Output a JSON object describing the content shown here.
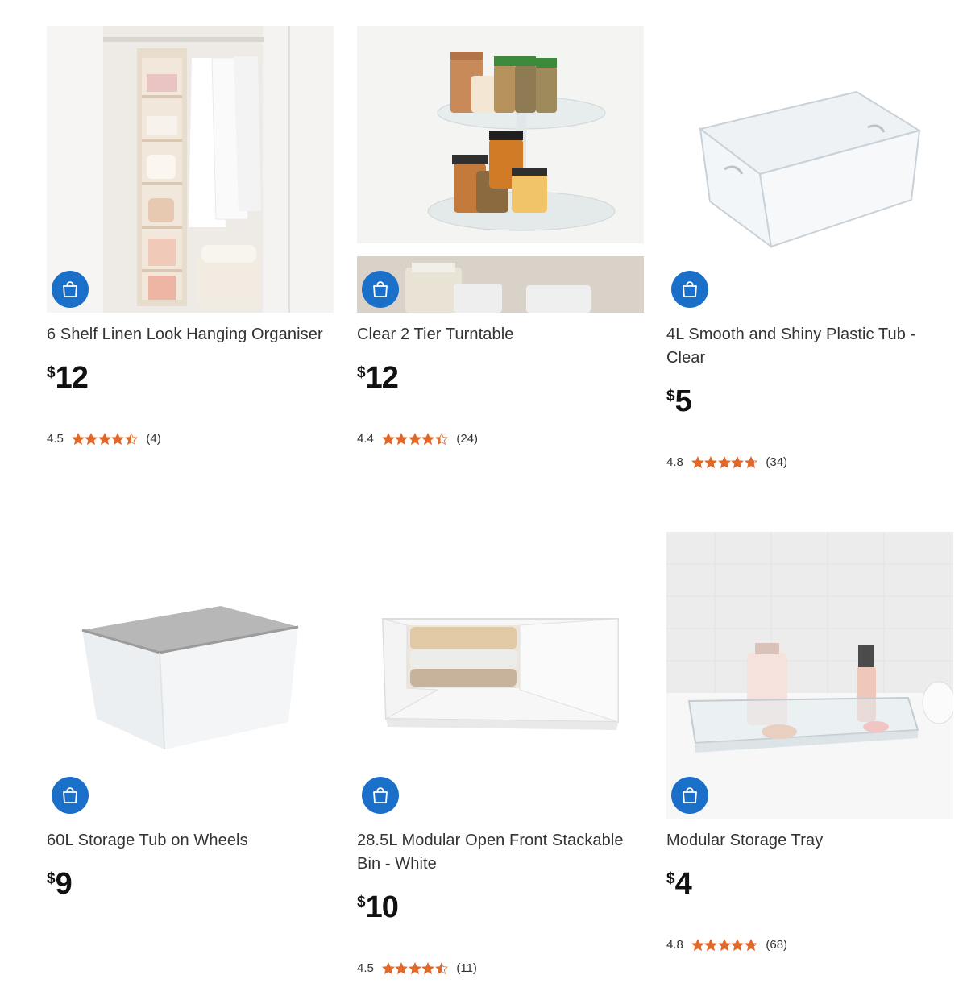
{
  "accent": "#1a6fc9",
  "star_color": "#e0692a",
  "products": [
    {
      "title": "6 Shelf Linen Look Hanging Organiser",
      "currency": "$",
      "price": "12",
      "rating": "4.5",
      "stars": 4.5,
      "count": "(4)",
      "cart_icon": "shopping-bag-icon"
    },
    {
      "title": "Clear 2 Tier Turntable",
      "currency": "$",
      "price": "12",
      "rating": "4.4",
      "stars": 4.4,
      "count": "(24)",
      "cart_icon": "shopping-bag-icon"
    },
    {
      "title": "4L Smooth and Shiny Plastic Tub - Clear",
      "currency": "$",
      "price": "5",
      "rating": "4.8",
      "stars": 4.8,
      "count": "(34)",
      "cart_icon": "shopping-bag-icon"
    },
    {
      "title": "60L Storage Tub on Wheels",
      "currency": "$",
      "price": "9",
      "cart_icon": "shopping-bag-icon"
    },
    {
      "title": "28.5L Modular Open Front Stackable Bin - White",
      "currency": "$",
      "price": "10",
      "rating": "4.5",
      "stars": 4.5,
      "count": "(11)",
      "cart_icon": "shopping-bag-icon"
    },
    {
      "title": "Modular Storage Tray",
      "currency": "$",
      "price": "4",
      "rating": "4.8",
      "stars": 4.8,
      "count": "(68)",
      "cart_icon": "shopping-bag-icon"
    }
  ]
}
